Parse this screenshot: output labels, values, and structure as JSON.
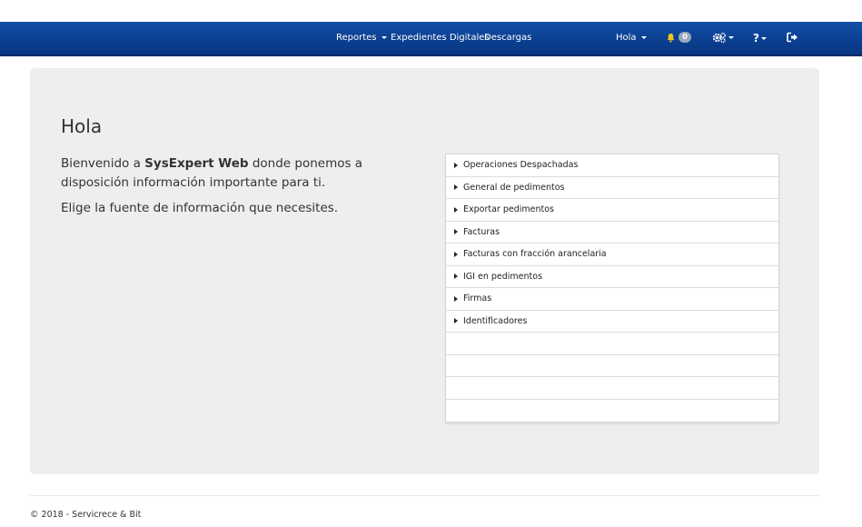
{
  "navbar": {
    "reportes_label": "Reportes",
    "expedientes_label": "Expedientes Digitales",
    "descargas_label": "Descargas",
    "user_label": "Hola",
    "notification_count": "0",
    "icons": [
      "bell-icon",
      "gears-icon",
      "help-icon",
      "sign-out-icon"
    ],
    "colors": {
      "bar": "#0b3f91",
      "badge": "#9aa9be",
      "bell": "#f5c518"
    }
  },
  "main": {
    "title": "Hola",
    "welcome_prefix": "Bienvenido a ",
    "welcome_brand": "SysExpert Web",
    "welcome_suffix": " donde ponemos a disposición información importante para ti.",
    "instruction": "Elige la fuente de información que necesites."
  },
  "reports": [
    {
      "label": "Operaciones Despachadas"
    },
    {
      "label": "General de pedimentos"
    },
    {
      "label": "Exportar pedimentos"
    },
    {
      "label": "Facturas"
    },
    {
      "label": "Facturas con fracción arancelaria"
    },
    {
      "label": "IGI en pedimentos"
    },
    {
      "label": "Firmas"
    },
    {
      "label": "Identificadores"
    },
    {
      "label": ""
    },
    {
      "label": ""
    },
    {
      "label": ""
    },
    {
      "label": ""
    }
  ],
  "footer": {
    "text": "© 2018 - Servicrece & Bit"
  }
}
